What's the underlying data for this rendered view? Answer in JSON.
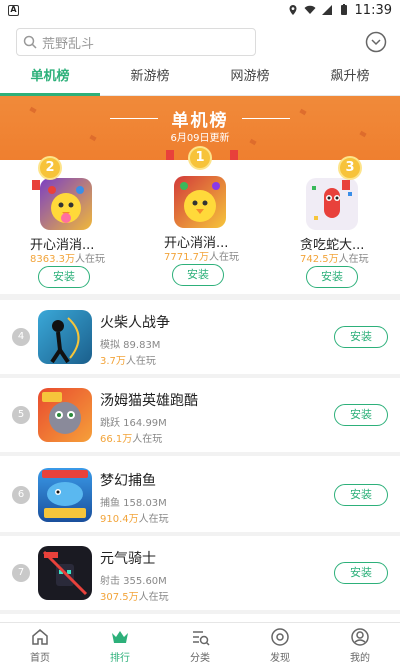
{
  "status_bar": {
    "time": "11:39"
  },
  "search": {
    "placeholder": "荒野乱斗"
  },
  "tabs": [
    {
      "label": "单机榜",
      "active": true
    },
    {
      "label": "新游榜",
      "active": false
    },
    {
      "label": "网游榜",
      "active": false
    },
    {
      "label": "飙升榜",
      "active": false
    }
  ],
  "banner": {
    "title": "单机榜",
    "date": "6月09日更新"
  },
  "top3": [
    {
      "rank": "2",
      "name": "开心消消...",
      "count": "8363.3万",
      "suffix": "人在玩",
      "button": "安装"
    },
    {
      "rank": "1",
      "name": "开心消消...",
      "count": "7771.7万",
      "suffix": "人在玩",
      "button": "安装"
    },
    {
      "rank": "3",
      "name": "贪吃蛇大...",
      "count": "742.5万",
      "suffix": "人在玩",
      "button": "安装"
    }
  ],
  "list": [
    {
      "rank": "4",
      "name": "火柴人战争",
      "meta": "模拟 89.83M",
      "plays": "3.7万",
      "suffix": "人在玩",
      "button": "安装"
    },
    {
      "rank": "5",
      "name": "汤姆猫英雄跑酷",
      "meta": "跳跃 164.99M",
      "plays": "66.1万",
      "suffix": "人在玩",
      "button": "安装"
    },
    {
      "rank": "6",
      "name": "梦幻捕鱼",
      "meta": "捕鱼 158.03M",
      "plays": "910.4万",
      "suffix": "人在玩",
      "button": "安装"
    },
    {
      "rank": "7",
      "name": "元气骑士",
      "meta": "射击 355.60M",
      "plays": "307.5万",
      "suffix": "人在玩",
      "button": "安装"
    }
  ],
  "bottom_nav": [
    {
      "label": "首页",
      "icon": "home-icon",
      "active": false
    },
    {
      "label": "排行",
      "icon": "crown-icon",
      "active": true
    },
    {
      "label": "分类",
      "icon": "category-icon",
      "active": false
    },
    {
      "label": "发现",
      "icon": "discover-icon",
      "active": false
    },
    {
      "label": "我的",
      "icon": "user-icon",
      "active": false
    }
  ],
  "colors": {
    "accent": "#2db07a",
    "banner": "#ef7f2f",
    "gold": "#f2a43a"
  }
}
